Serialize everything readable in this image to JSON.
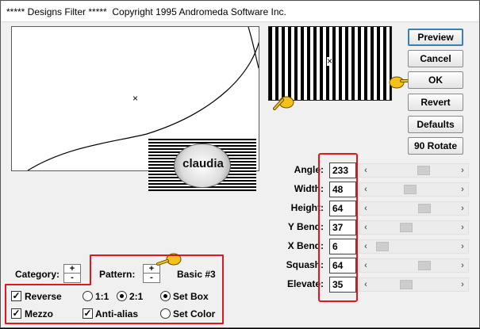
{
  "window": {
    "title": "***** Designs Filter *****  Copyright 1995 Andromeda Software Inc."
  },
  "buttons": {
    "preview": "Preview",
    "cancel": "Cancel",
    "ok": "OK",
    "revert": "Revert",
    "defaults": "Defaults",
    "rotate": "90 Rotate"
  },
  "params": [
    {
      "label": "Angle:",
      "value": "233",
      "level": 0.62
    },
    {
      "label": "Width:",
      "value": "48",
      "level": 0.44
    },
    {
      "label": "Height:",
      "value": "64",
      "level": 0.63
    },
    {
      "label": "Y Bend:",
      "value": "37",
      "level": 0.38
    },
    {
      "label": "X Bend:",
      "value": "6",
      "level": 0.06
    },
    {
      "label": "Squash:",
      "value": "64",
      "level": 0.63
    },
    {
      "label": "Elevate:",
      "value": "35",
      "level": 0.38
    }
  ],
  "spinners": {
    "plus": "+",
    "minus": "-"
  },
  "category": {
    "label": "Category:"
  },
  "pattern": {
    "label": "Pattern:",
    "name": "Basic #3"
  },
  "options": {
    "reverse": {
      "label": "Reverse",
      "checked": true
    },
    "mezzo": {
      "label": "Mezzo",
      "checked": true
    },
    "antialias": {
      "label": "Anti-alias",
      "checked": true
    },
    "ratio_1_1": {
      "label": "1:1",
      "selected": false
    },
    "ratio_2_1": {
      "label": "2:1",
      "selected": true
    },
    "set_box": {
      "label": "Set Box",
      "selected": true
    },
    "set_color": {
      "label": "Set Color",
      "selected": false
    }
  },
  "marks": {
    "check": "✓",
    "cross": "×"
  },
  "watermark": {
    "text": "claudia"
  },
  "colors": {
    "highlight": "#e0171f",
    "default_button": "#3c7fb1"
  }
}
